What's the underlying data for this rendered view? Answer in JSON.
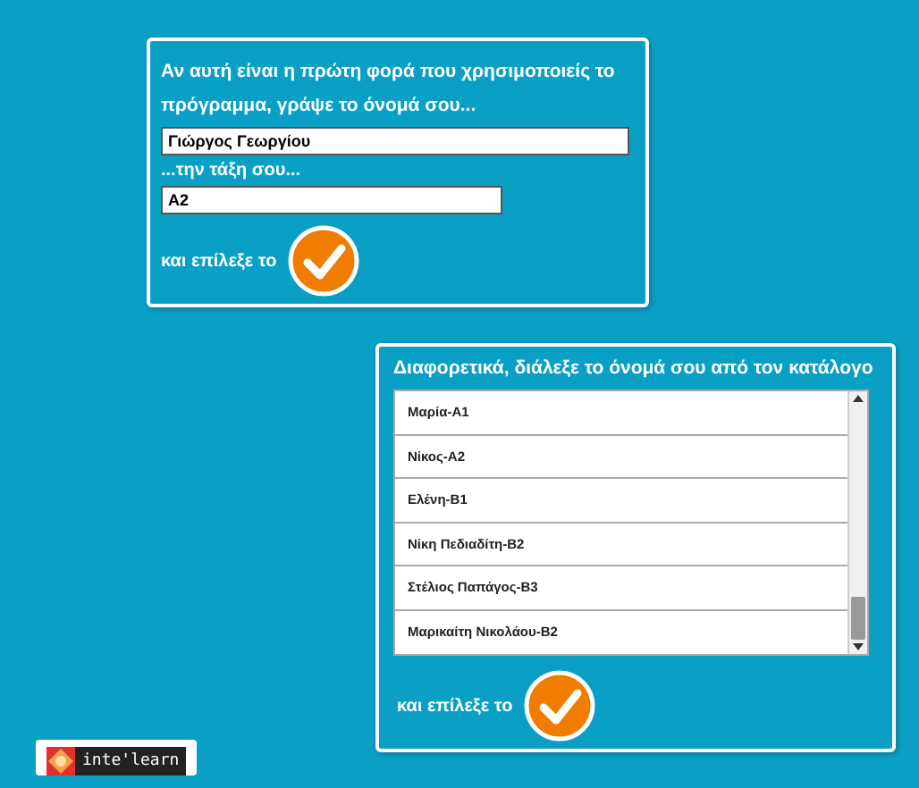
{
  "new_user_panel": {
    "intro": "Αν αυτή είναι η πρώτη φορά που χρησιμοποιείς το πρόγραμμα, γράψε το όνομά σου...",
    "name_field": {
      "value": "Γιώργος Γεωργίου"
    },
    "class_label": "...την τάξη σου...",
    "class_field": {
      "value": "A2"
    },
    "confirm_label": "και επίλεξε το"
  },
  "existing_user_panel": {
    "heading": "Διαφορετικά, διάλεξε το όνομά σου από τον κατάλογο",
    "names": [
      {
        "label": "Μαρία-Α1"
      },
      {
        "label": "Νίκος-Α2"
      },
      {
        "label": "Ελένη-Β1"
      },
      {
        "label": "Νίκη Πεδιαδίτη-Β2"
      },
      {
        "label": "Στέλιος Παπάγος-Β3"
      },
      {
        "label": "Μαρικαίτη Νικολάου-Β2"
      }
    ],
    "confirm_label": "και επίλεξε το"
  },
  "logo": {
    "text": "inte'learn"
  }
}
